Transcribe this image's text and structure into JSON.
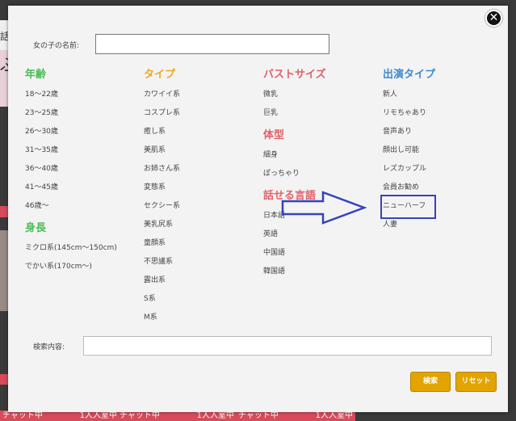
{
  "background": {
    "side_text_top": "話",
    "side_text_mid": "ぷ",
    "tags": [
      "チ",
      "チャット中",
      "1人入室中",
      "チャット中",
      "1人入室中",
      "チャット中",
      "1人入室中"
    ]
  },
  "modal": {
    "close_label": "✕",
    "name_label": "女の子の名前:",
    "name_value": "",
    "columns": {
      "age": {
        "title": "年齢",
        "items": [
          "18〜22歳",
          "23〜25歳",
          "26〜30歳",
          "31〜35歳",
          "36〜40歳",
          "41〜45歳",
          "46歳〜"
        ]
      },
      "height": {
        "title": "身長",
        "items": [
          "ミクロ系(145cm〜150cm)",
          "でかい系(170cm〜)"
        ]
      },
      "type": {
        "title": "タイプ",
        "items": [
          "カワイイ系",
          "コスプレ系",
          "癒し系",
          "美肌系",
          "お姉さん系",
          "変態系",
          "セクシー系",
          "美乳尻系",
          "童顔系",
          "不思議系",
          "露出系",
          "S系",
          "M系"
        ]
      },
      "bust": {
        "title": "バストサイズ",
        "items": [
          "微乳",
          "巨乳"
        ]
      },
      "body": {
        "title": "体型",
        "items": [
          "細身",
          "ぽっちゃり"
        ]
      },
      "language": {
        "title": "話せる言語",
        "items": [
          "日本語",
          "英語",
          "中国語",
          "韓国語"
        ]
      },
      "performance": {
        "title": "出演タイプ",
        "items": [
          "新人",
          "リモちゃあり",
          "音声あり",
          "顔出し可能",
          "レズカップル",
          "会員お勧め",
          "ニューハーフ",
          "人妻"
        ]
      }
    },
    "search_label": "検索内容:",
    "search_value": "",
    "search_button": "検索",
    "reset_button": "リセット"
  },
  "colors": {
    "age": "#4cbb58",
    "type": "#f0a51f",
    "bust": "#e0616a",
    "performance": "#3f8ad0",
    "button": "#e3a400",
    "annotation": "#3444b8"
  }
}
